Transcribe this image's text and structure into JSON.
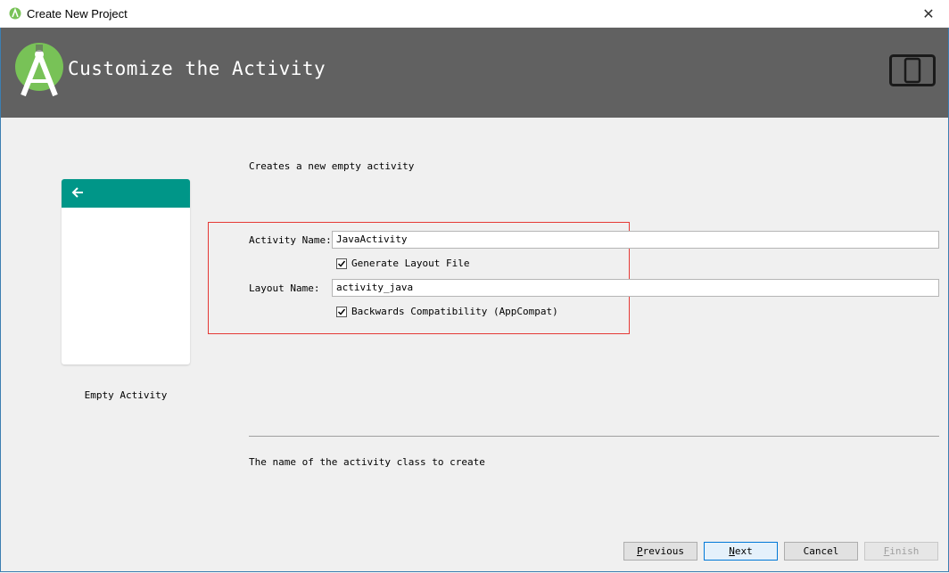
{
  "window": {
    "title": "Create New Project",
    "close_glyph": "✕"
  },
  "banner": {
    "title": "Customize the Activity",
    "logo_icon": "android-studio-icon",
    "device_icon": "phone-tablet-icon"
  },
  "template": {
    "name": "Empty Activity",
    "toolbar_color": "#009688"
  },
  "form": {
    "description": "Creates a new empty activity",
    "activity_name_label": "Activity Name:",
    "activity_name_value": "JavaActivity",
    "generate_layout_label": "Generate Layout File",
    "generate_layout_checked": true,
    "layout_name_label": "Layout Name:",
    "layout_name_value": "activity_java",
    "backwards_label": "Backwards Compatibility (AppCompat)",
    "backwards_checked": true
  },
  "help_text": "The name of the activity class to create",
  "buttons": {
    "previous": {
      "mnemonic": "P",
      "rest": "revious"
    },
    "next": {
      "mnemonic": "N",
      "rest": "ext"
    },
    "cancel": {
      "label": "Cancel"
    },
    "finish": {
      "mnemonic": "F",
      "rest": "inish"
    }
  }
}
